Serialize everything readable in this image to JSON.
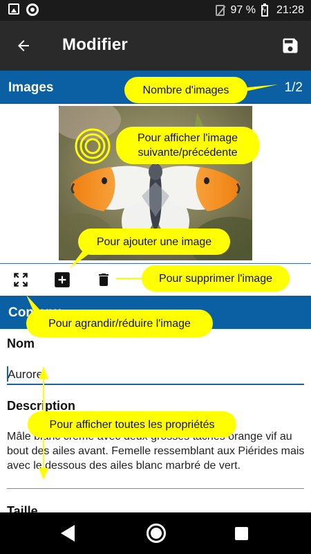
{
  "status_bar": {
    "battery": "97 %",
    "time": "21:28"
  },
  "app_bar": {
    "title": "Modifier"
  },
  "images_section": {
    "title": "Images",
    "count": "1/2"
  },
  "contenu_section": {
    "title": "Contenu"
  },
  "fields": {
    "nom_label": "Nom",
    "nom_value": "Aurore",
    "description_label": "Description",
    "description_value": "Mâle blanc crème avec deux grosses taches orange vif au bout des ailes avant. Femelle ressemblant aux Piérides mais avec le dessous des ailes blanc marbré de vert.",
    "taille_label": "Taille"
  },
  "annotations": {
    "nombre_images": "Nombre d'images",
    "afficher_image_line1": "Pour afficher l'image",
    "afficher_image_line2": "suivante/précédente",
    "ajouter_image": "Pour ajouter une image",
    "supprimer_image": "Pour supprimer l'image",
    "agrandir_reduire": "Pour agrandir/réduire l'image",
    "afficher_proprietes": "Pour afficher toutes les propriétés"
  },
  "icons": {
    "back": "arrow-back-icon",
    "save": "floppy-disk-icon",
    "expand": "fullscreen-icon",
    "add": "add-box-icon",
    "delete": "trash-icon"
  },
  "colors": {
    "section_header": "#0b5fa3",
    "app_bar": "#2a2a2a",
    "annotation": "#ffff00",
    "accent": "#1e5fa3"
  }
}
